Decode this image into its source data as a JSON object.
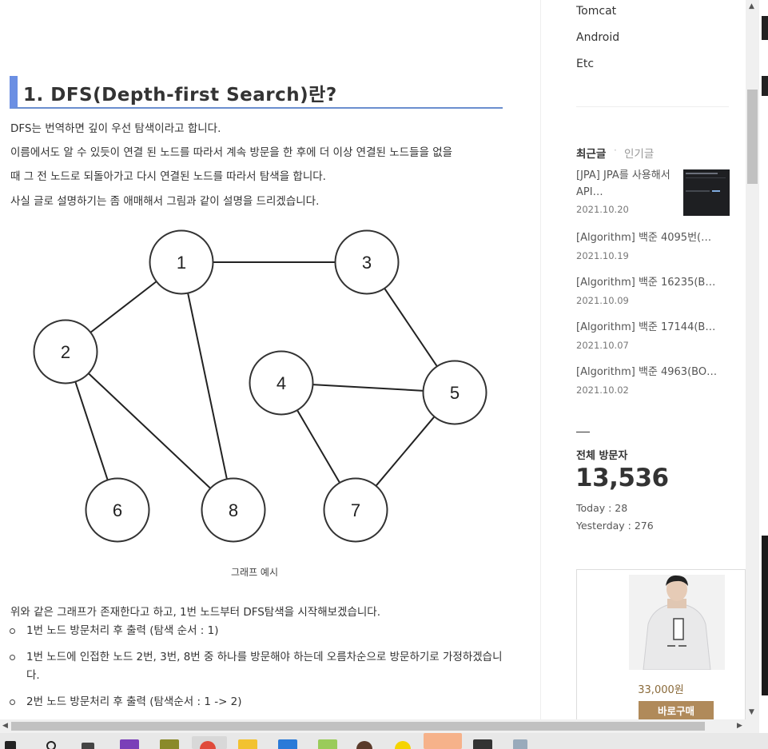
{
  "article": {
    "heading": "1. DFS(Depth-first Search)란?",
    "paragraphs": [
      "DFS는 번역하면 깊이 우선 탐색이라고 합니다.",
      "이름에서도 알 수 있듯이 연결 된 노드를 따라서 계속 방문을 한 후에 더 이상 연결된 노드들을 없을",
      "때 그 전 노드로 되돌아가고 다시 연결된 노드를 따라서 탐색을 합니다.",
      "사실 글로 설명하기는 좀 애매해서 그림과 같이 설명을 드리겠습니다."
    ],
    "caption": "그래프 예시",
    "intro": "위와 같은 그래프가 존재한다고 하고, 1번 노드부터 DFS탐색을 시작해보겠습니다.",
    "steps": [
      "1번 노드 방문처리 후 출력 (탐색 순서 : 1)",
      "1번 노드에 인접한 노드 2번, 3번, 8번 중 하나를 방문해야 하는데 오름차순으로 방문하기로 가정하겠습니다.",
      "2번 노드 방문처리 후 출력 (탐색순서 : 1 -> 2)"
    ]
  },
  "graph": {
    "nodes": [
      {
        "id": "1",
        "label": "1"
      },
      {
        "id": "2",
        "label": "2"
      },
      {
        "id": "3",
        "label": "3"
      },
      {
        "id": "4",
        "label": "4"
      },
      {
        "id": "5",
        "label": "5"
      },
      {
        "id": "6",
        "label": "6"
      },
      {
        "id": "7",
        "label": "7"
      },
      {
        "id": "8",
        "label": "8"
      }
    ],
    "edges": [
      [
        "1",
        "2"
      ],
      [
        "1",
        "3"
      ],
      [
        "1",
        "8"
      ],
      [
        "2",
        "6"
      ],
      [
        "2",
        "8"
      ],
      [
        "3",
        "5"
      ],
      [
        "4",
        "5"
      ],
      [
        "4",
        "7"
      ],
      [
        "5",
        "7"
      ]
    ]
  },
  "sidebar": {
    "categories": [
      "Tomcat",
      "Android",
      "Etc"
    ],
    "tabs": {
      "recent": "최근글",
      "popular": "인기글"
    },
    "posts": [
      {
        "title": "[JPA] JPA를 사용해서 API…",
        "date": "2021.10.20"
      },
      {
        "title": "[Algorithm] 백준 4095번(…",
        "date": "2021.10.19"
      },
      {
        "title": "[Algorithm] 백준 16235(B…",
        "date": "2021.10.09"
      },
      {
        "title": "[Algorithm] 백준 17144(B…",
        "date": "2021.10.07"
      },
      {
        "title": "[Algorithm] 백준 4963(BO…",
        "date": "2021.10.02"
      }
    ],
    "visitors": {
      "label": "전체 방문자",
      "total": "13,536",
      "today": "Today : 28",
      "yesterday": "Yesterday : 276"
    },
    "ad": {
      "price": "33,000원",
      "button": "바로구매"
    }
  },
  "scrollbar": {
    "up": "▲",
    "down": "▼",
    "left": "◀",
    "right": "▶"
  },
  "colors": {
    "heading_accent": "#6b8fe3",
    "heading_underline": "#6a8ecf",
    "ad_button": "#b08a5a",
    "price": "#8a6a3a"
  },
  "taskbar_icons": [
    "windows-icon",
    "search-icon",
    "task-view-icon",
    "visual-studio-icon",
    "app-icon",
    "chrome-icon",
    "file-explorer-icon",
    "store-icon",
    "paint-icon",
    "game-icon",
    "kakaotalk-icon",
    "java-icon",
    "terminal-icon",
    "recycle-icon"
  ]
}
